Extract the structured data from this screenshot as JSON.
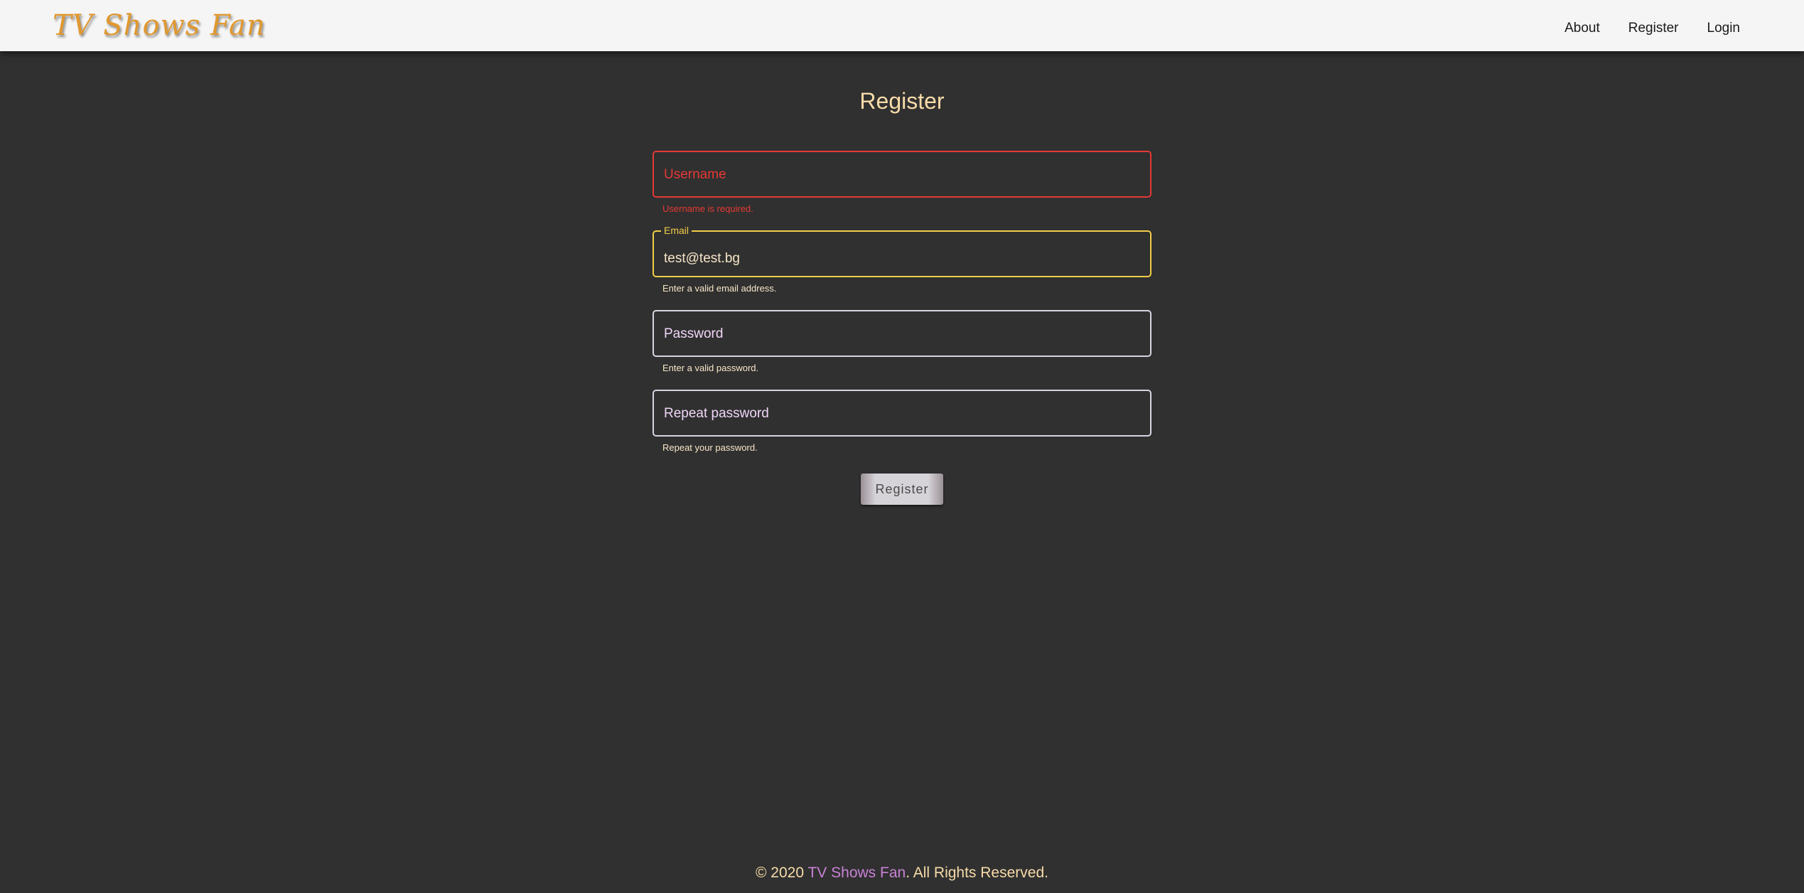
{
  "navbar": {
    "brand": "TV Shows Fan",
    "links": [
      {
        "label": "About"
      },
      {
        "label": "Register"
      },
      {
        "label": "Login"
      }
    ]
  },
  "page": {
    "title": "Register"
  },
  "form": {
    "username": {
      "placeholder": "Username",
      "hint": "Username is required.",
      "state": "error"
    },
    "email": {
      "label": "Email",
      "value": "test@test.bg",
      "hint": "Enter a valid email address.",
      "state": "focused"
    },
    "password": {
      "placeholder": "Password",
      "hint": "Enter a valid password."
    },
    "repeat_password": {
      "placeholder": "Repeat password",
      "hint": "Repeat your password."
    },
    "submit_label": "Register"
  },
  "footer": {
    "prefix": "© 2020 ",
    "brand": "TV Shows Fan",
    "suffix": ". All Rights Reserved."
  },
  "colors": {
    "background": "#303030",
    "navbar": "#f5f5f5",
    "brand": "#e0982f",
    "error": "#e53935",
    "focus": "#f2cd48",
    "text_accent": "#f8dba8",
    "footer_link": "#c982d6"
  }
}
